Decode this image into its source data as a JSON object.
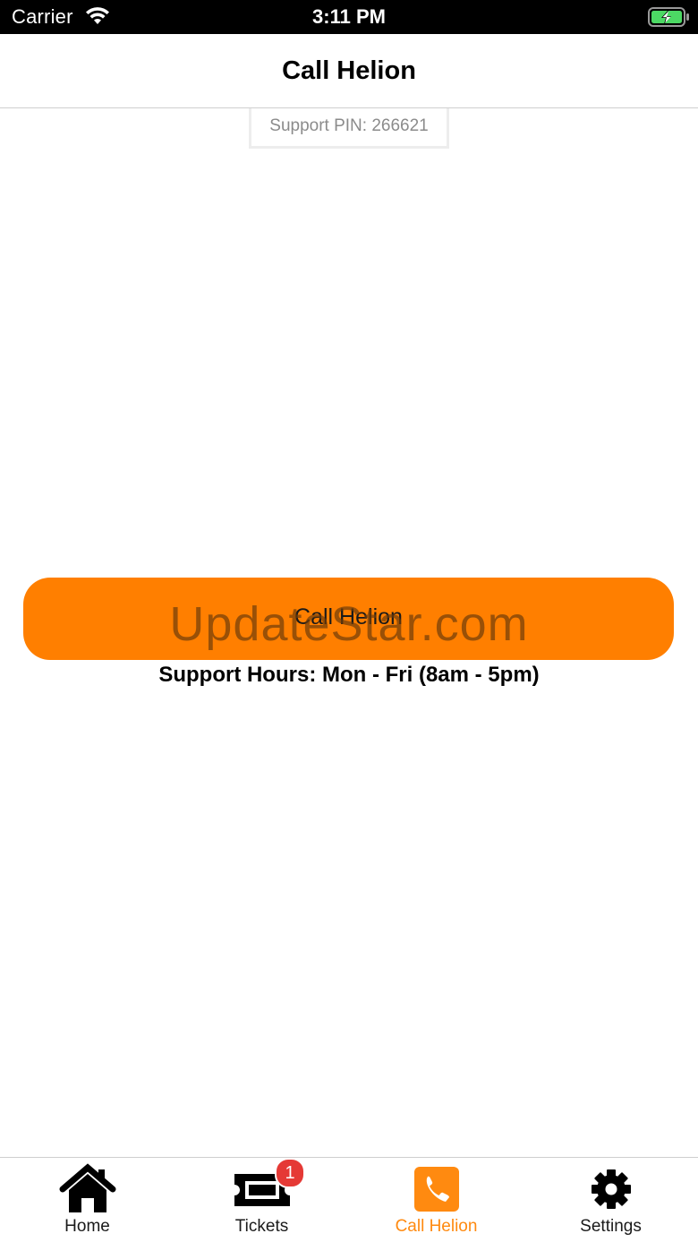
{
  "status_bar": {
    "carrier": "Carrier",
    "time": "3:11 PM"
  },
  "nav": {
    "title": "Call Helion"
  },
  "support": {
    "pin_text": "Support PIN: 266621",
    "call_button_label": "Call Helion",
    "hours_text": "Support Hours: Mon - Fri (8am - 5pm)"
  },
  "watermark": "UpdateStar.com",
  "tabs": [
    {
      "label": "Home",
      "icon": "home-icon",
      "active": false
    },
    {
      "label": "Tickets",
      "icon": "ticket-icon",
      "active": false,
      "badge": "1"
    },
    {
      "label": "Call Helion",
      "icon": "phone-icon",
      "active": true
    },
    {
      "label": "Settings",
      "icon": "gear-icon",
      "active": false
    }
  ],
  "colors": {
    "accent": "#ff7f00",
    "tab_active": "#ff8a10",
    "badge": "#e53935",
    "battery_fill": "#4cd964"
  }
}
